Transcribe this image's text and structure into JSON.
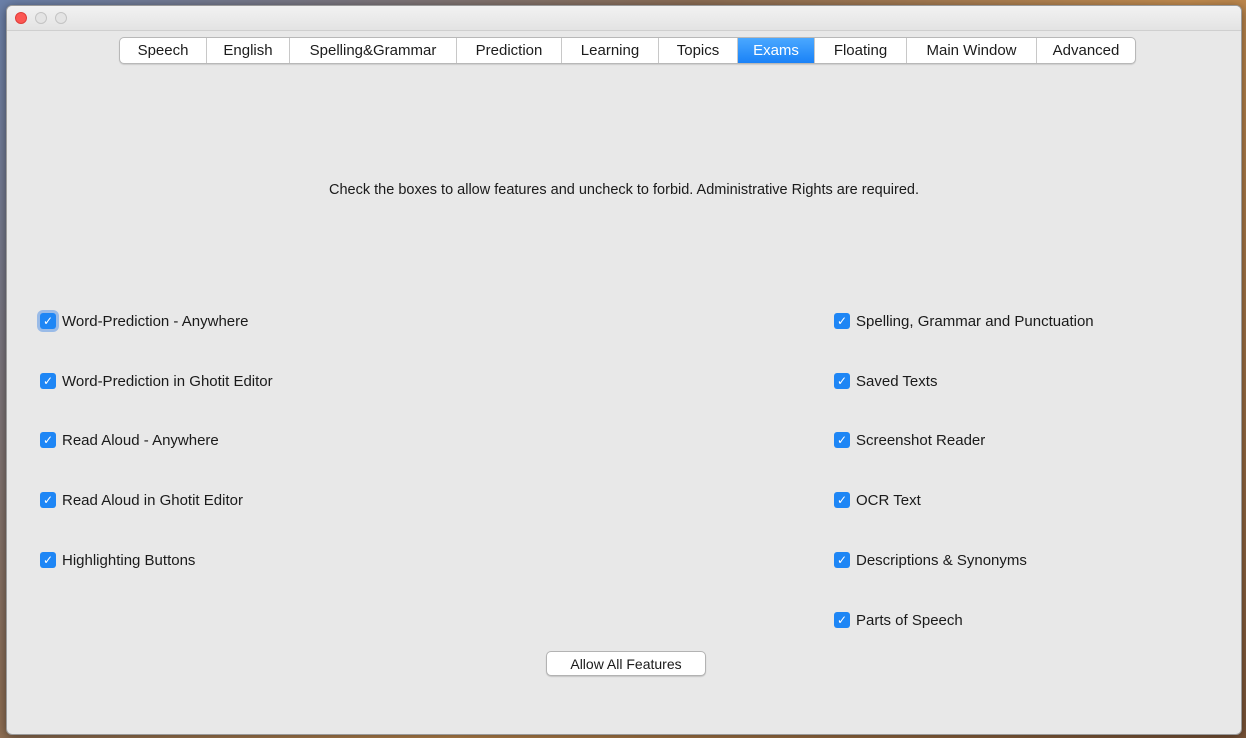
{
  "window": {
    "controls": [
      "close",
      "minimize",
      "maximize"
    ]
  },
  "tabs": [
    {
      "label": "Speech",
      "active": false
    },
    {
      "label": "English",
      "active": false
    },
    {
      "label": "Spelling&Grammar",
      "active": false
    },
    {
      "label": "Prediction",
      "active": false
    },
    {
      "label": "Learning",
      "active": false
    },
    {
      "label": "Topics",
      "active": false
    },
    {
      "label": "Exams",
      "active": true
    },
    {
      "label": "Floating",
      "active": false
    },
    {
      "label": "Main Window",
      "active": false
    },
    {
      "label": "Advanced",
      "active": false
    }
  ],
  "instruction": "Check the boxes to allow features and uncheck to forbid.  Administrative Rights are required.",
  "left_features": [
    {
      "label": "Word-Prediction - Anywhere",
      "checked": true
    },
    {
      "label": "Word-Prediction in Ghotit Editor",
      "checked": true
    },
    {
      "label": "Read Aloud - Anywhere",
      "checked": true
    },
    {
      "label": "Read Aloud in Ghotit Editor",
      "checked": true
    },
    {
      "label": "Highlighting Buttons",
      "checked": true
    }
  ],
  "right_features": [
    {
      "label": "Spelling, Grammar and Punctuation",
      "checked": true
    },
    {
      "label": "Saved Texts",
      "checked": true
    },
    {
      "label": "Screenshot Reader",
      "checked": true
    },
    {
      "label": "OCR Text",
      "checked": true
    },
    {
      "label": "Descriptions & Synonyms",
      "checked": true
    },
    {
      "label": "Parts of Speech",
      "checked": true
    }
  ],
  "allow_all_label": "Allow All Features",
  "colors": {
    "accent": "#1e86f5",
    "close_button": "#fc5753",
    "window_background": "#e8e8e8"
  }
}
